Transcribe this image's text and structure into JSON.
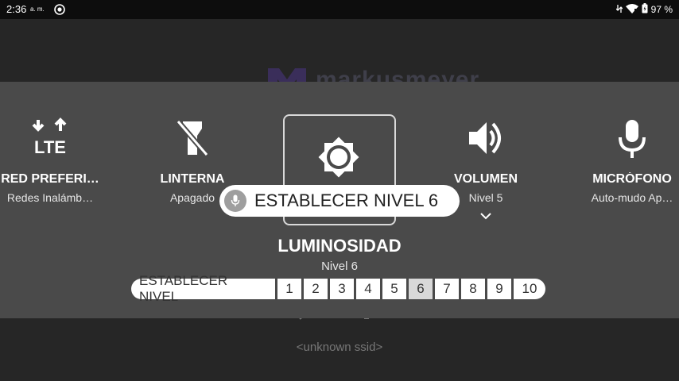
{
  "status_bar": {
    "time": "2:36",
    "ampm": "a. m.",
    "battery": "97 %",
    "icons": [
      "chrome-icon",
      "data-arrows-icon",
      "wifi-icon",
      "battery-icon"
    ]
  },
  "background": {
    "logo_text": "markusmeyer",
    "ssid": "<unknown ssid>"
  },
  "tiles": [
    {
      "label": "RED PREFERI…",
      "sub": "Redes Inalámb…",
      "icon": "lte-icon"
    },
    {
      "label": "LINTERNA",
      "sub": "Apagado",
      "icon": "flashlight-off-icon"
    },
    {
      "label": "VOLUMEN",
      "sub": "Nivel 5",
      "icon": "volume-icon"
    },
    {
      "label": "MICRÓFONO",
      "sub": "Auto-mudo Ap…",
      "icon": "microphone-icon"
    }
  ],
  "brightness": {
    "title": "LUMINOSIDAD",
    "sub": "Nivel 6",
    "icon": "brightness-icon"
  },
  "voice_hint": {
    "text": "ESTABLECER NIVEL 6",
    "icon": "mic-icon"
  },
  "level_bar": {
    "label": "ESTABLECER NIVEL",
    "levels": [
      "1",
      "2",
      "3",
      "4",
      "5",
      "6",
      "7",
      "8",
      "9",
      "10"
    ],
    "selected": "6"
  },
  "colors": {
    "panel": "#4a4a4a",
    "background": "#262626",
    "status_bar": "#0d0d0d"
  }
}
